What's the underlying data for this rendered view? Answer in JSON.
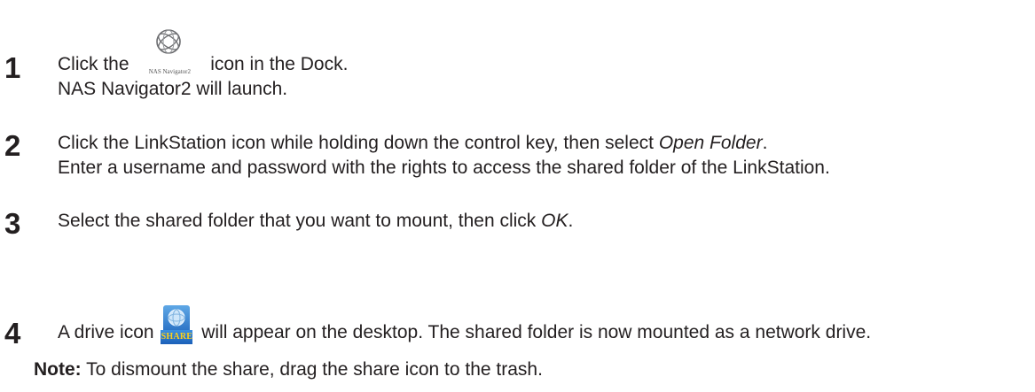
{
  "steps": [
    {
      "number": "1",
      "line1_before": "Click the ",
      "icon_label": "NAS Navigator2",
      "line1_after": " icon in the Dock.",
      "line2": "NAS Navigator2 will launch."
    },
    {
      "number": "2",
      "line1_before": "Click the LinkStation icon while holding down the control key, then select ",
      "line1_emphasis": "Open Folder",
      "line1_after": ".",
      "line2": "Enter a username and password with the rights to access the shared folder of the LinkStation."
    },
    {
      "number": "3",
      "line1_before": "Select the shared folder that you want to mount, then click ",
      "line1_emphasis": "OK",
      "line1_after": "."
    },
    {
      "number": "4",
      "line1_before": "A drive icon ",
      "icon_label": "SHARE",
      "line1_after": " will appear on the desktop. The shared folder is now mounted as a network drive."
    }
  ],
  "note": {
    "label": "Note:",
    "text": " To dismount the share, drag the share icon to the trash."
  },
  "icons": {
    "nas_navigator": "nas-navigator-icon",
    "share_drive": "share-drive-icon"
  }
}
